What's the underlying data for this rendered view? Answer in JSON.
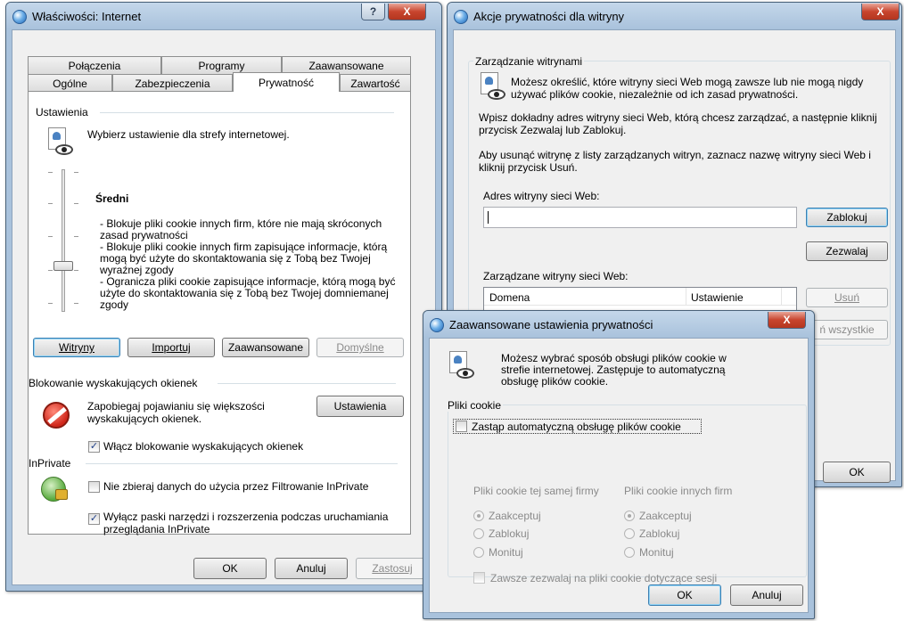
{
  "win1": {
    "title": "Właściwości: Internet",
    "help_glyph": "?",
    "close_glyph": "X",
    "tabs_row1": [
      "Połączenia",
      "Programy",
      "Zaawansowane"
    ],
    "tabs_row2": [
      "Ogólne",
      "Zabezpieczenia",
      "Prywatność",
      "Zawartość"
    ],
    "settings_group": "Ustawienia",
    "zone_text": "Wybierz ustawienie dla strefy internetowej.",
    "level_title": "Średni",
    "level_desc": "- Blokuje pliki cookie innych firm, które nie mają skróconych zasad prywatności\n- Blokuje pliki cookie innych firm zapisujące informacje, którą mogą być użyte do skontaktowania się z Tobą bez Twojej wyraźnej zgody\n- Ogranicza pliki cookie zapisujące informacje, którą mogą być użyte do skontaktowania się z Tobą bez Twojej domniemanej zgody",
    "btn_sites": "Witryny",
    "btn_import": "Importuj",
    "btn_advanced": "Zaawansowane",
    "btn_default": "Domyślne",
    "popup_group": "Blokowanie wyskakujących okienek",
    "popup_text": "Zapobiegaj pojawianiu się większości wyskakujących okienek.",
    "btn_popup_settings": "Ustawienia",
    "popup_checkbox": "Włącz blokowanie wyskakujących okienek",
    "inprivate_group": "InPrivate",
    "inprivate_cb1": "Nie zbieraj danych do użycia przez Filtrowanie InPrivate",
    "inprivate_cb2": "Wyłącz paski narzędzi i rozszerzenia podczas uruchamiania przeglądania InPrivate",
    "btn_ok": "OK",
    "btn_cancel": "Anuluj",
    "btn_apply": "Zastosuj",
    "check_glyph": "✓"
  },
  "win2": {
    "title": "Akcje prywatności dla witryny",
    "close_glyph": "X",
    "group": "Zarządzanie witrynami",
    "intro": "Możesz określić, które witryny sieci Web mogą zawsze lub nie mogą nigdy używać plików cookie, niezależnie od ich zasad prywatności.",
    "para1": "Wpisz dokładny adres witryny sieci Web, którą chcesz zarządzać, a następnie kliknij przycisk Zezwalaj lub Zablokuj.",
    "para2": "Aby usunąć witrynę z listy zarządzanych witryn, zaznacz nazwę witryny sieci Web i kliknij przycisk Usuń.",
    "address_label": "Adres witryny sieci Web:",
    "address_value": "",
    "btn_block": "Zablokuj",
    "btn_allow": "Zezwalaj",
    "managed_label": "Zarządzane witryny sieci Web:",
    "col_domain": "Domena",
    "col_setting": "Ustawienie",
    "btn_remove": "Usuń",
    "btn_remove_all": "ń wszystkie",
    "btn_ok": "OK"
  },
  "win3": {
    "title": "Zaawansowane ustawienia prywatności",
    "close_glyph": "X",
    "intro": "Możesz wybrać sposób obsługi plików cookie w strefie internetowej. Zastępuje to automatyczną obsługę plików cookie.",
    "group": "Pliki cookie",
    "override_cb": "Zastąp automatyczną obsługę plików cookie",
    "first_party": "Pliki cookie tej samej firmy",
    "third_party": "Pliki cookie innych firm",
    "opt_accept": "Zaakceptuj",
    "opt_block": "Zablokuj",
    "opt_prompt": "Monituj",
    "session_cb": "Zawsze zezwalaj na pliki cookie dotyczące sesji",
    "btn_ok": "OK",
    "btn_cancel": "Anuluj"
  }
}
